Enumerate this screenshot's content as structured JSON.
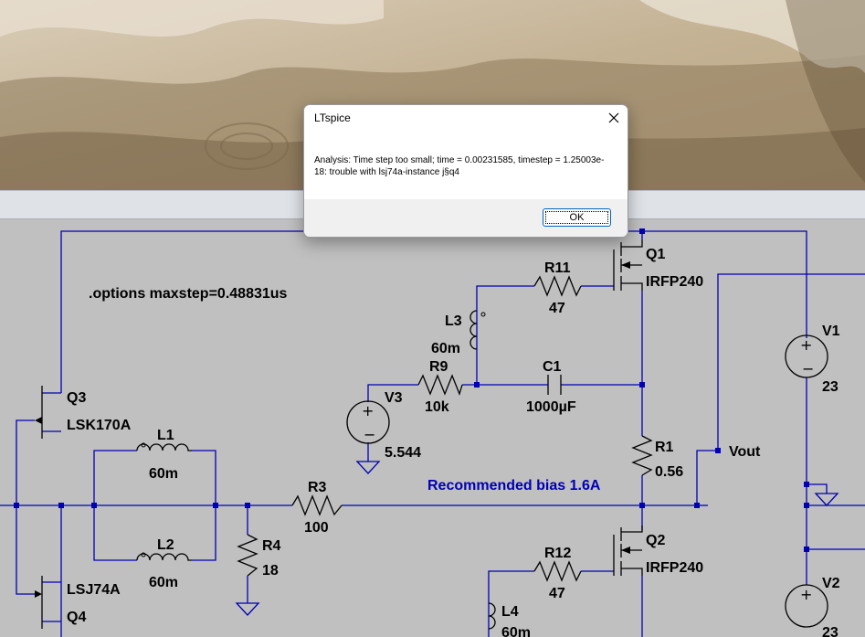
{
  "dialog": {
    "title": "LTspice",
    "message": "Analysis:  Time step too small; time = 0.00231585, timestep = 1.25003e-18: trouble with lsj74a-instance j§q4",
    "ok_label": "OK"
  },
  "schematic": {
    "directive": ".options maxstep=0.48831us",
    "note": "Recommended bias 1.6A",
    "components": {
      "q1": {
        "name": "Q1",
        "model": "IRFP240"
      },
      "q2": {
        "name": "Q2",
        "model": "IRFP240"
      },
      "q3": {
        "name": "Q3",
        "model": "LSK170A"
      },
      "q4": {
        "name": "Q4",
        "model": "LSJ74A"
      },
      "r11": {
        "name": "R11",
        "value": "47"
      },
      "r12": {
        "name": "R12",
        "value": "47"
      },
      "r9": {
        "name": "R9",
        "value": "10k"
      },
      "r1": {
        "name": "R1",
        "value": "0.56"
      },
      "r3": {
        "name": "R3",
        "value": "100"
      },
      "r4": {
        "name": "R4",
        "value": "18"
      },
      "l1": {
        "name": "L1",
        "value": "60m"
      },
      "l2": {
        "name": "L2",
        "value": "60m"
      },
      "l3": {
        "name": "L3",
        "value": "60m"
      },
      "l4": {
        "name": "L4",
        "value": "60m"
      },
      "c1": {
        "name": "C1",
        "value": "1000µF"
      },
      "v1": {
        "name": "V1",
        "value": "23"
      },
      "v2": {
        "name": "V2",
        "value": "23"
      },
      "v3": {
        "name": "V3",
        "value": "5.544"
      }
    },
    "vout_label": "Vout"
  },
  "colors": {
    "wire": "#0000b4",
    "canvas": "#c0c0c0",
    "note_text": "#0000b4"
  },
  "icons": {
    "close": "close-icon"
  }
}
